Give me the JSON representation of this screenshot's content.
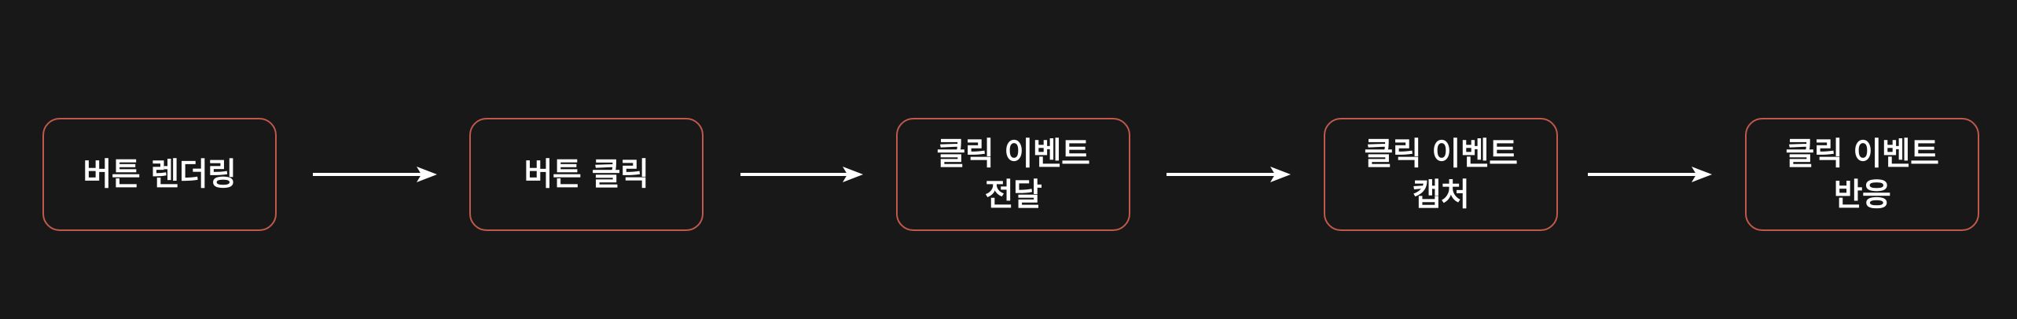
{
  "colors": {
    "background": "#181818",
    "node_border": "#c0584c",
    "text": "#ffffff",
    "arrow": "#ffffff"
  },
  "nodes": [
    {
      "label": "버튼 렌더링"
    },
    {
      "label": "버튼 클릭"
    },
    {
      "label": "클릭 이벤트\n전달"
    },
    {
      "label": "클릭 이벤트\n캡처"
    },
    {
      "label": "클릭 이벤트\n반응"
    }
  ]
}
